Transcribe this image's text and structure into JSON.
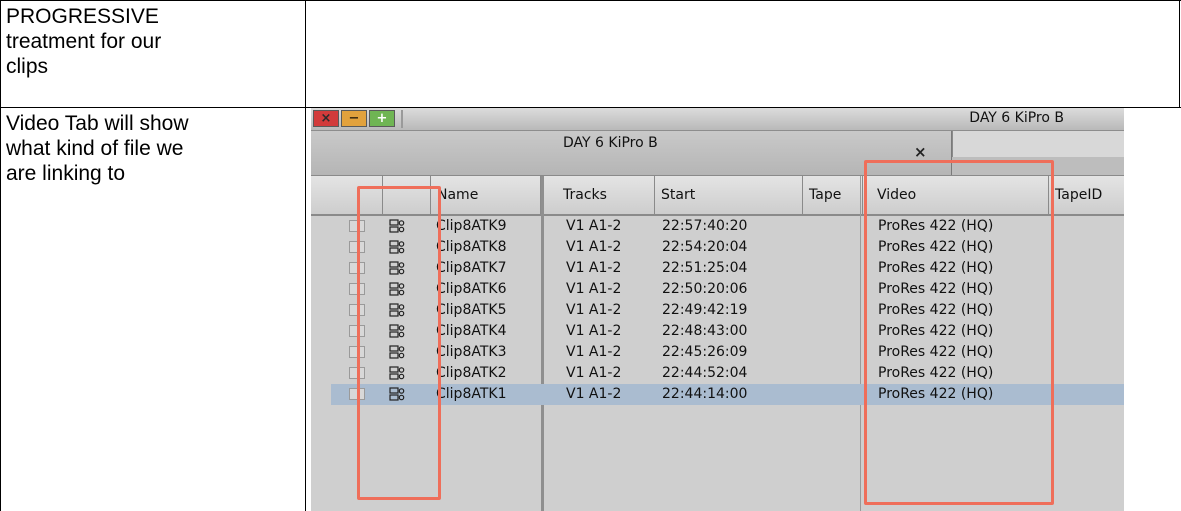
{
  "document": {
    "row1_text": [
      "PROGRESSIVE",
      "treatment for our",
      "clips"
    ],
    "row2_text": [
      "Video Tab will show",
      "what kind of file we",
      "are linking to"
    ]
  },
  "bin": {
    "window_title": "DAY 6 KiPro B",
    "window_buttons": {
      "close": "×",
      "minimize": "−",
      "maximize": "+"
    },
    "tab_label": "DAY 6 KiPro B",
    "tab_close": "×",
    "columns": [
      "Name",
      "Tracks",
      "Start",
      "Tape",
      "Video",
      "TapeID"
    ],
    "rows": [
      {
        "name": "Clip8ATK9",
        "tracks": "V1 A1-2",
        "start": "22:57:40:20",
        "video": "ProRes 422 (HQ)",
        "selected": false
      },
      {
        "name": "Clip8ATK8",
        "tracks": "V1 A1-2",
        "start": "22:54:20:04",
        "video": "ProRes 422 (HQ)",
        "selected": false
      },
      {
        "name": "Clip8ATK7",
        "tracks": "V1 A1-2",
        "start": "22:51:25:04",
        "video": "ProRes 422 (HQ)",
        "selected": false
      },
      {
        "name": "Clip8ATK6",
        "tracks": "V1 A1-2",
        "start": "22:50:20:06",
        "video": "ProRes 422 (HQ)",
        "selected": false
      },
      {
        "name": "Clip8ATK5",
        "tracks": "V1 A1-2",
        "start": "22:49:42:19",
        "video": "ProRes 422 (HQ)",
        "selected": false
      },
      {
        "name": "Clip8ATK4",
        "tracks": "V1 A1-2",
        "start": "22:48:43:00",
        "video": "ProRes 422 (HQ)",
        "selected": false
      },
      {
        "name": "Clip8ATK3",
        "tracks": "V1 A1-2",
        "start": "22:45:26:09",
        "video": "ProRes 422 (HQ)",
        "selected": false
      },
      {
        "name": "Clip8ATK2",
        "tracks": "V1 A1-2",
        "start": "22:44:52:04",
        "video": "ProRes 422 (HQ)",
        "selected": false
      },
      {
        "name": "Clip8ATK1",
        "tracks": "V1 A1-2",
        "start": "22:44:14:00",
        "video": "ProRes 422 (HQ)",
        "selected": true
      }
    ],
    "icons": {
      "row_checkbox": "checkbox-icon",
      "row_clip": "master-clip-icon"
    },
    "colors": {
      "highlight": "#ef6e5a",
      "selection": "#aabcd0",
      "close_button": "#d23b3b",
      "minimize_button": "#e2a23d",
      "maximize_button": "#6fb553"
    }
  }
}
